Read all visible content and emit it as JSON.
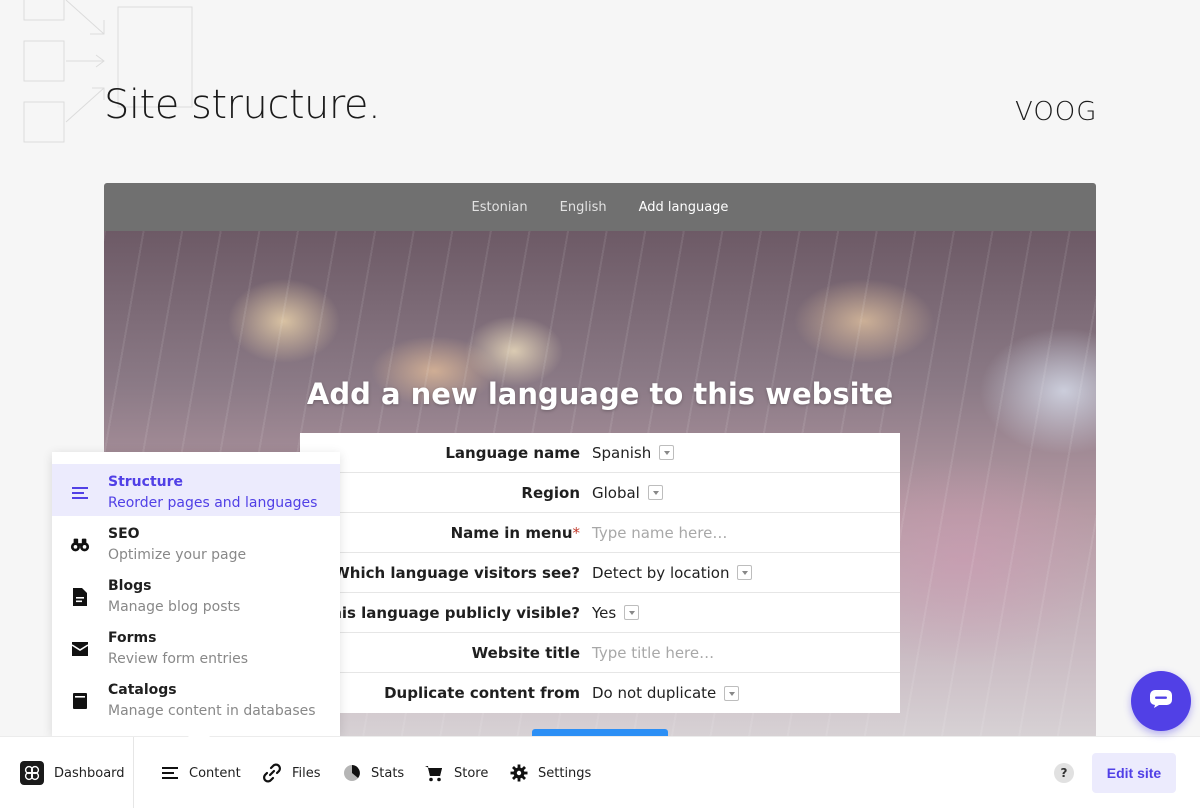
{
  "page": {
    "title": "Site structure."
  },
  "brand": {
    "logo_text": "VOOG"
  },
  "languages": {
    "tabs": [
      {
        "label": "Estonian"
      },
      {
        "label": "English"
      },
      {
        "label": "Add language"
      }
    ],
    "active_tab": "Add language"
  },
  "form": {
    "heading": "Add a new language to this website",
    "fields": [
      {
        "label": "Language name",
        "value": "Spanish",
        "type": "select"
      },
      {
        "label": "Region",
        "value": "Global",
        "type": "select"
      },
      {
        "label": "Name in menu",
        "required_mark": "*",
        "placeholder": "Type name here…",
        "type": "text"
      },
      {
        "label": "Which language visitors see?",
        "value": "Detect by location",
        "type": "select"
      },
      {
        "label": "Is this language publicly visible?",
        "value": "Yes",
        "type": "select"
      },
      {
        "label": "Website title",
        "placeholder": "Type title here…",
        "type": "text"
      },
      {
        "label": "Duplicate content from",
        "value": "Do not duplicate",
        "type": "select"
      }
    ]
  },
  "content_menu": {
    "items": [
      {
        "title": "Structure",
        "subtitle": "Reorder pages and languages",
        "icon": "structure-icon",
        "active": true
      },
      {
        "title": "SEO",
        "subtitle": "Optimize your page",
        "icon": "binoculars-icon"
      },
      {
        "title": "Blogs",
        "subtitle": "Manage blog posts",
        "icon": "document-icon"
      },
      {
        "title": "Forms",
        "subtitle": "Review form entries",
        "icon": "envelope-icon"
      },
      {
        "title": "Catalogs",
        "subtitle": "Manage content in databases",
        "icon": "catalog-icon"
      }
    ]
  },
  "bottombar": {
    "dashboard": "Dashboard",
    "content": "Content",
    "files": "Files",
    "stats": "Stats",
    "store": "Store",
    "settings": "Settings",
    "help": "?",
    "edit_site": "Edit site"
  },
  "colors": {
    "accent": "#5140e6",
    "accent_bg": "#ecebfd",
    "tab_bar": "#707070",
    "submit": "#2c8ff5"
  }
}
